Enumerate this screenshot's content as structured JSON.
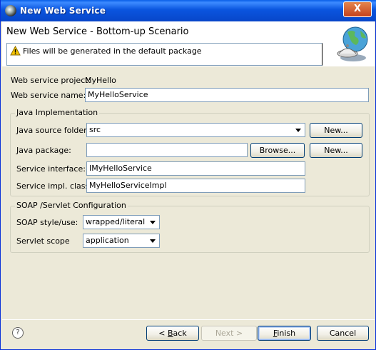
{
  "window": {
    "title": "New Web Service",
    "close_label": "X"
  },
  "banner": {
    "title": "New Web Service - Bottom-up Scenario",
    "message": "Files will be generated in the default package"
  },
  "project": {
    "label": "Web service project:",
    "value": "MyHello"
  },
  "service_name": {
    "label": "Web service name:",
    "value": "MyHelloService"
  },
  "java_impl": {
    "group_title": "Java Implementation",
    "source_folder_label": "Java source folder:",
    "source_folder_value": "src",
    "source_new_label": "New...",
    "package_label": "Java package:",
    "package_value": "",
    "browse_label": "Browse...",
    "package_new_label": "New...",
    "interface_label": "Service interface:",
    "interface_value": "IMyHelloService",
    "impl_class_label": "Service impl. class:",
    "impl_class_value": "MyHelloServiceImpl"
  },
  "soap": {
    "group_title": "SOAP /Servlet Configuration",
    "style_label": "SOAP style/use:",
    "style_value": "wrapped/literal",
    "scope_label": "Servlet scope",
    "scope_value": "application"
  },
  "footer": {
    "help_glyph": "?",
    "back_prefix": "< ",
    "back_mnemonic": "B",
    "back_rest": "ack",
    "next_label": "Next >",
    "finish_mnemonic": "F",
    "finish_rest": "inish",
    "cancel_label": "Cancel"
  }
}
